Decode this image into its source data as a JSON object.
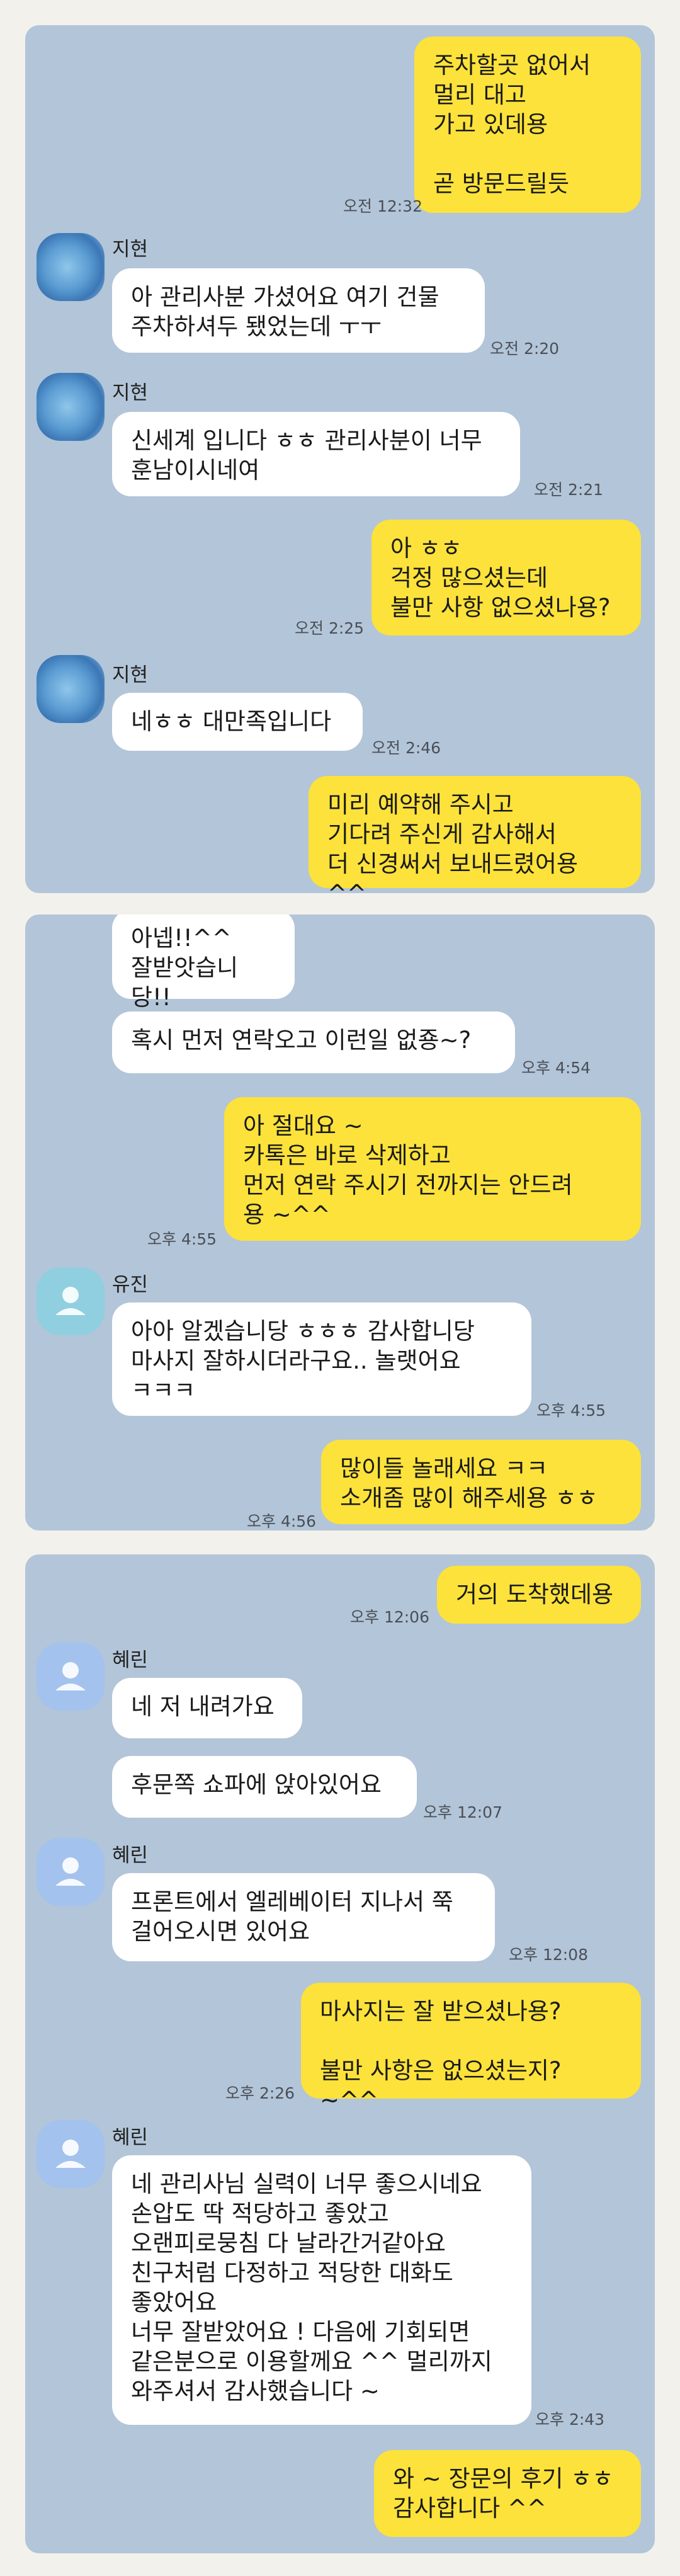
{
  "panel1": {
    "messages": [
      {
        "from": "me",
        "text": "주차할곳 없어서\n멀리 대고\n가고 있데용\n\n곧 방문드릴듯",
        "time": "오전 12:32"
      },
      {
        "from": "지현",
        "text": "아 관리사분 가셨어요 여기 건물\n주차하셔두 됐었는데 ㅜㅜ",
        "time": "오전 2:20"
      },
      {
        "from": "지현",
        "text": "신세계 입니다 ㅎㅎ 관리사분이 너무\n훈남이시네여",
        "time": "오전 2:21"
      },
      {
        "from": "me",
        "text": "아 ㅎㅎ\n걱정 많으셨는데\n불만 사항 없으셨나용?",
        "time": "오전 2:25"
      },
      {
        "from": "지현",
        "text": "네ㅎㅎ 대만족입니다",
        "time": "오전 2:46"
      },
      {
        "from": "me",
        "text": "미리 예약해 주시고\n기다려 주신게 감사해서\n더 신경써서 보내드렸어용 ^^",
        "time": ""
      }
    ]
  },
  "panel2": {
    "messages": [
      {
        "from": "other",
        "text": "아넵!!^^\n잘받앗습니당!!",
        "time": ""
      },
      {
        "from": "other",
        "text": "혹시 먼저 연락오고 이런일 없죵~?",
        "time": "오후 4:54"
      },
      {
        "from": "me",
        "text": "아 절대요 ~\n카톡은 바로 삭제하고\n먼저 연락 주시기 전까지는 안드려\n용 ~^^",
        "time": "오후 4:55"
      },
      {
        "from": "유진",
        "text": "아아 알겠습니당 ㅎㅎㅎ 감사합니당\n마사지 잘하시더라구요.. 놀랫어요\nㅋㅋㅋ",
        "time": "오후 4:55"
      },
      {
        "from": "me",
        "text": "많이들 놀래세요 ㅋㅋ\n소개좀 많이 해주세용 ㅎㅎ",
        "time": "오후 4:56"
      }
    ]
  },
  "panel3": {
    "messages": [
      {
        "from": "me",
        "text": "거의 도착했데용",
        "time": "오후 12:06"
      },
      {
        "from": "혜린",
        "text": "네 저 내려가요",
        "time": ""
      },
      {
        "from": "혜린",
        "text": "후문쪽 쇼파에 앉아있어요",
        "time": "오후 12:07"
      },
      {
        "from": "혜린",
        "text": "프론트에서 엘레베이터 지나서 쭉\n걸어오시면 있어요",
        "time": "오후 12:08"
      },
      {
        "from": "me",
        "text": "마사지는 잘 받으셨나용?\n\n불만 사항은 없으셨는지? ~^^",
        "time": "오후 2:26"
      },
      {
        "from": "혜린",
        "text": "네 관리사님 실력이 너무 좋으시네요\n손압도 딱 적당하고 좋았고\n오랜피로뭉침 다 날라간거같아요\n친구처럼 다정하고 적당한 대화도\n좋았어요\n너무 잘받았어요 ! 다음에 기회되면\n같은분으로 이용할께요 ^^ 멀리까지\n와주셔서 감사했습니다 ~",
        "time": "오후 2:43"
      },
      {
        "from": "me",
        "text": "와 ~ 장문의 후기 ㅎㅎ\n감사합니다 ^^",
        "time": ""
      }
    ]
  }
}
